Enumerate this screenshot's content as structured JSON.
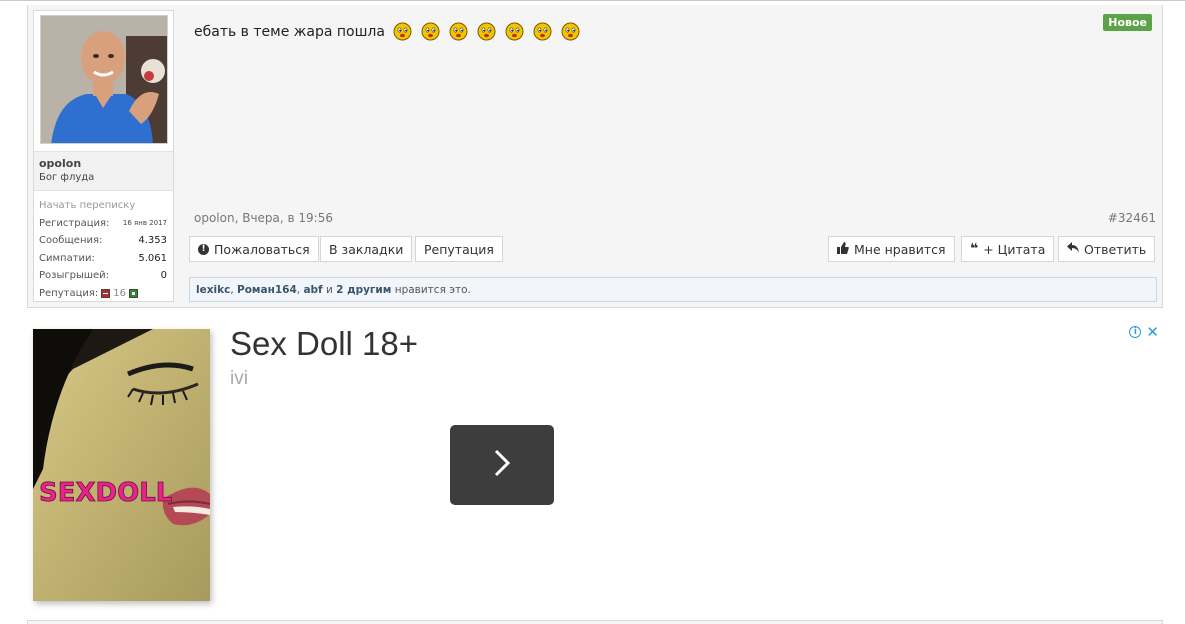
{
  "post": {
    "user": {
      "name": "opolon",
      "title": "Бог флуда",
      "start_convo": "Начать переписку",
      "stats": {
        "registration_label": "Регистрация:",
        "registration_value": "16 янв 2017",
        "messages_label": "Сообщения:",
        "messages_value": "4.353",
        "likes_label": "Симпатии:",
        "likes_value": "5.061",
        "giveaways_label": "Розыгрышей:",
        "giveaways_value": "0",
        "reputation_label": "Репутация:",
        "reputation_value": "16"
      }
    },
    "message": "ебать в теме жара пошла",
    "smiley_count": 7,
    "badge": "Новое",
    "meta": "opolon, Вчера, в 19:56",
    "post_number": "#32461",
    "actions": {
      "report": "Пожаловаться",
      "bookmarks": "В закладки",
      "reputation": "Репутация",
      "like": "Мне нравится",
      "quote": "+ Цитата",
      "reply": "Ответить"
    },
    "likes_bar": {
      "user1": "lexikc",
      "user2": "Роман164",
      "user3": "abf",
      "and": "и",
      "others": "2 другим",
      "suffix": "нравится это."
    }
  },
  "ad": {
    "title": "Sex Doll 18+",
    "source": "ivi",
    "image_text": "SEXDOLL",
    "info_icon": "info-icon",
    "close_icon": "close-icon"
  },
  "colors": {
    "badge_green": "#5ba346",
    "likes_bar_bg": "#f2f6fa",
    "ad_accent": "#2e9bd6",
    "ad_button": "#3d3d3d"
  }
}
